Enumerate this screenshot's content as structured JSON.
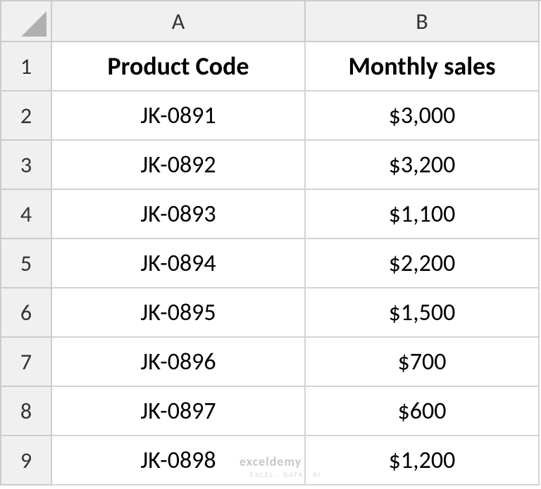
{
  "columns": [
    "A",
    "B"
  ],
  "rows": [
    "1",
    "2",
    "3",
    "4",
    "5",
    "6",
    "7",
    "8",
    "9"
  ],
  "headers": {
    "col_a": "Product Code",
    "col_b": "Monthly sales"
  },
  "data": [
    {
      "code": "JK-0891",
      "sales": "$3,000"
    },
    {
      "code": "JK-0892",
      "sales": "$3,200"
    },
    {
      "code": "JK-0893",
      "sales": "$1,100"
    },
    {
      "code": "JK-0894",
      "sales": "$2,200"
    },
    {
      "code": "JK-0895",
      "sales": "$1,500"
    },
    {
      "code": "JK-0896",
      "sales": "$700"
    },
    {
      "code": "JK-0897",
      "sales": "$600"
    },
    {
      "code": "JK-0898",
      "sales": "$1,200"
    }
  ],
  "watermark": {
    "main": "exceldemy",
    "sub": "EXCEL · DATA · BI"
  }
}
